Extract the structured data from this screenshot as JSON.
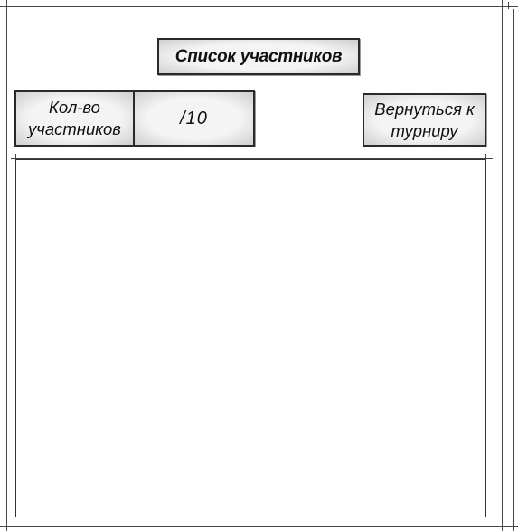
{
  "window": {
    "title": "Список участников"
  },
  "participants": {
    "count_label": "Кол-во участников",
    "count_value": "/10",
    "back_button_label": "Вернуться к турниру",
    "items": []
  }
}
